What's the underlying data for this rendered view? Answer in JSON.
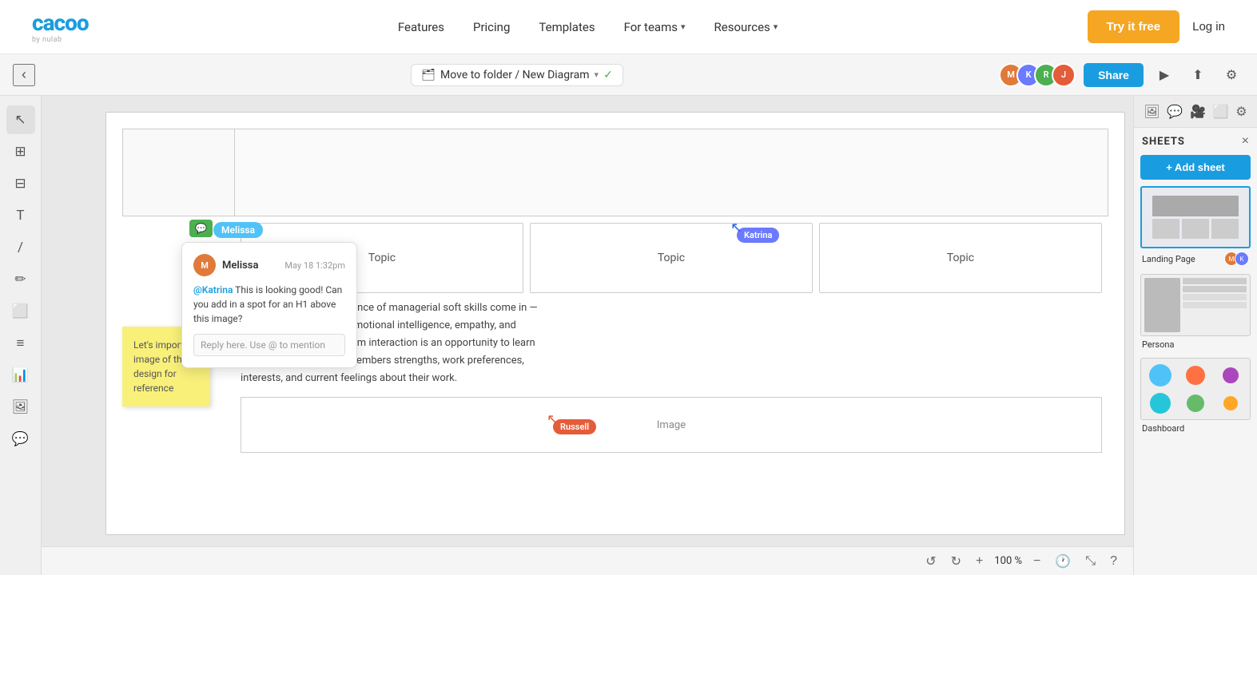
{
  "nav": {
    "logo": "cacoo",
    "logo_sub": "by nulab",
    "links": [
      {
        "id": "features",
        "label": "Features",
        "dropdown": false
      },
      {
        "id": "pricing",
        "label": "Pricing",
        "dropdown": false
      },
      {
        "id": "templates",
        "label": "Templates",
        "dropdown": false
      },
      {
        "id": "for-teams",
        "label": "For teams",
        "dropdown": true
      },
      {
        "id": "resources",
        "label": "Resources",
        "dropdown": true
      }
    ],
    "try_free": "Try it free",
    "login": "Log in"
  },
  "toolbar": {
    "back_label": "‹",
    "folder_path": "Move to folder / New Diagram",
    "check": "✓",
    "share_label": "Share",
    "play_icon": "▶",
    "export_icon": "⬆",
    "settings_icon": "⚙"
  },
  "canvas": {
    "diagram_title": "New Diagram",
    "melissa_label": "Melissa",
    "katrina_label": "Katrina",
    "russell_label": "Russell",
    "comment": {
      "author": "Melissa",
      "time": "May 18 1:32pm",
      "text": "@Katrina This is looking good! Can you add in a spot for an H1 above this image?",
      "reply_placeholder": "Reply here. Use @ to mention"
    },
    "sticky_note": "Let's import an image of the design for reference",
    "topics": [
      "Topic",
      "Topic",
      "Topic"
    ],
    "body_text": "This is where the importance of managerial soft skills come in — skills like high levels of emotional intelligence, empathy, and active listening. Every team interaction is an opportunity to learn more about each team members strengths, work preferences, interests, and current feelings about their work.",
    "image_label": "Image"
  },
  "right_panel": {
    "title": "SHEETS",
    "close": "×",
    "add_sheet": "+ Add sheet",
    "sheets": [
      {
        "id": "landing-page",
        "label": "Landing Page",
        "active": true
      },
      {
        "id": "persona",
        "label": "Persona",
        "active": false
      },
      {
        "id": "dashboard",
        "label": "Dashboard",
        "active": false
      }
    ]
  },
  "panel_icons": [
    "🖼",
    "💬",
    "📹",
    "⬜",
    "⚙"
  ],
  "tools": [
    "↖",
    "⊞",
    "⊟",
    "T",
    "/",
    "✏",
    "⬜",
    "≡",
    "📊",
    "🖼",
    "💬"
  ],
  "zoom": {
    "zoom_out": "−",
    "zoom_in": "+",
    "level": "100 %",
    "undo": "↺",
    "redo": "↻",
    "help": "?"
  },
  "colors": {
    "accent_blue": "#1a9de0",
    "try_free_orange": "#f5a623",
    "katrina_blue": "#6b7aff",
    "russell_orange": "#e55c3a",
    "comment_green": "#4caf50",
    "melissa_cyan": "#00bcd4"
  }
}
